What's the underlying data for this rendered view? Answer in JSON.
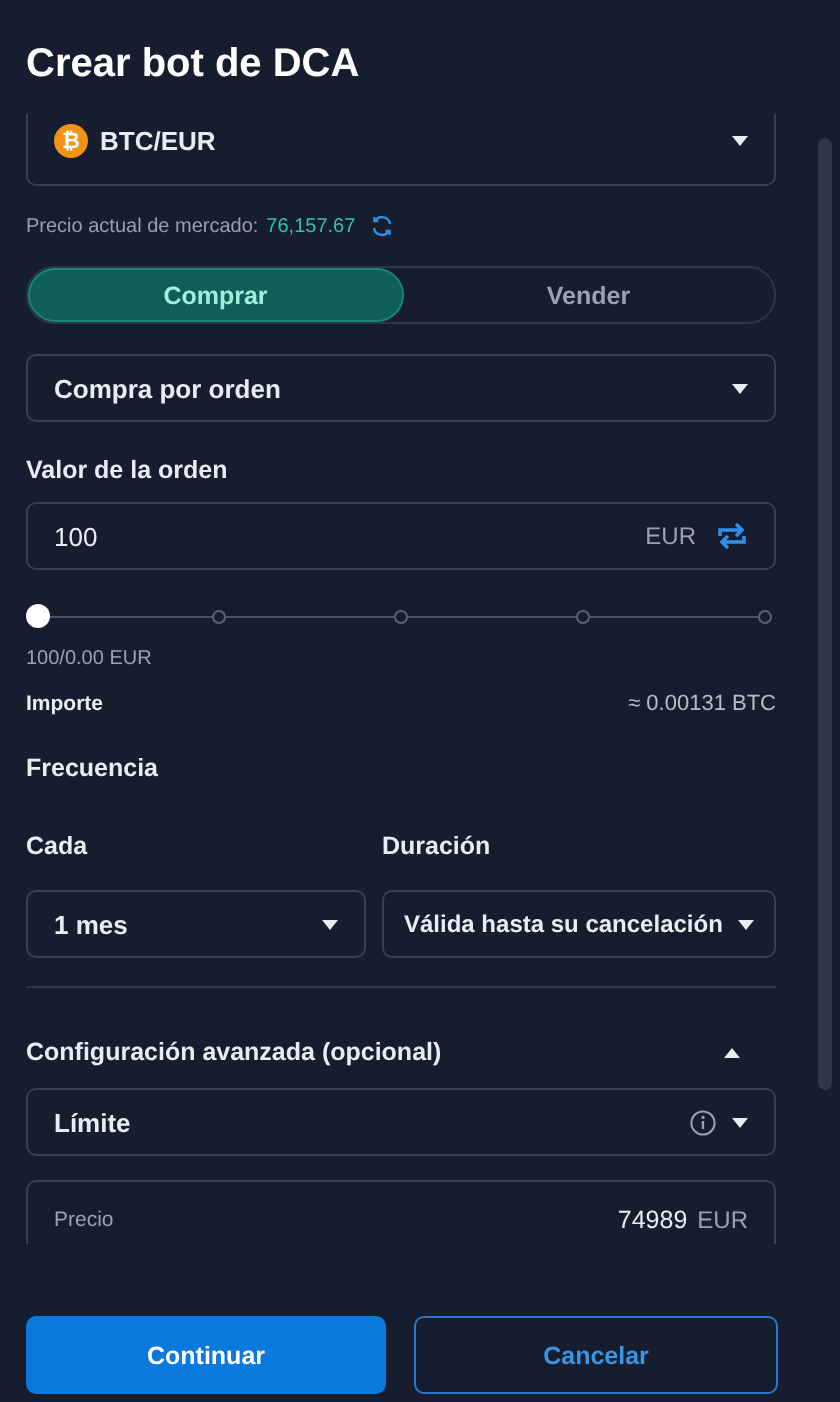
{
  "title": "Crear bot de DCA",
  "pair": {
    "icon": "₿",
    "value": "BTC/EUR"
  },
  "market_price": {
    "label": "Precio actual de mercado:",
    "value": "76,157.67"
  },
  "side_tabs": [
    {
      "label": "Comprar",
      "selected": true
    },
    {
      "label": "Vender",
      "selected": false
    }
  ],
  "order_type": {
    "value": "Compra por orden"
  },
  "order_value": {
    "label": "Valor de la orden",
    "value": "100",
    "unit": "EUR"
  },
  "amount_slider": {
    "level": 0,
    "reading": "100/0.00 EUR"
  },
  "importe": {
    "label": "Importe",
    "value": "≈ 0.00131 BTC"
  },
  "frequency": {
    "label": "Frecuencia"
  },
  "every": {
    "label": "Cada",
    "value": "1 mes"
  },
  "duration": {
    "label": "Duración",
    "value": "Válida hasta su cancelación"
  },
  "advanced": {
    "label": "Configuración avanzada (opcional)",
    "expanded": true,
    "limit": {
      "value": "Límite"
    },
    "price": {
      "label": "Precio",
      "value": "74989",
      "unit": "EUR"
    }
  },
  "buttons": [
    {
      "label": "Continuar",
      "kind": "primary"
    },
    {
      "label": "Cancelar",
      "kind": "secondary"
    }
  ]
}
